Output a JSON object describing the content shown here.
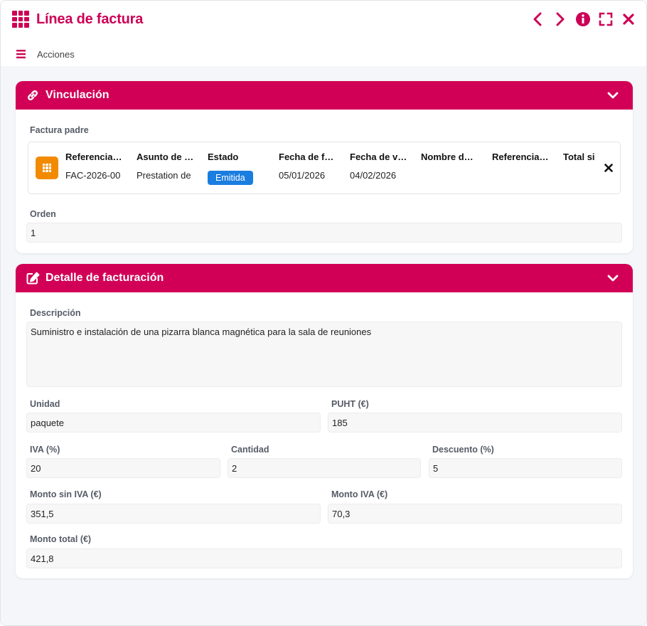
{
  "window": {
    "title": "Línea de factura"
  },
  "toolbar": {
    "actions_label": "Acciones"
  },
  "colors": {
    "accent": "#d10056",
    "badge": "#1a7de0",
    "thumb": "#f28a00"
  },
  "vinculacion": {
    "title": "Vinculación",
    "parent_label": "Factura padre",
    "columns": [
      "Referencia…",
      "Asunto de …",
      "Estado",
      "Fecha de f…",
      "Fecha de v…",
      "Nombre d…",
      "Referencia…",
      "Total si"
    ],
    "row": {
      "referencia": "FAC-2026-00",
      "asunto": "Prestation de",
      "estado": "Emitida",
      "fecha_f": "05/01/2026",
      "fecha_v": "04/02/2026"
    },
    "orden_label": "Orden",
    "orden_value": "1"
  },
  "detalle": {
    "title": "Detalle de facturación",
    "descripcion_label": "Descripción",
    "descripcion_value": "Suministro e instalación de una pizarra blanca magnética para la sala de reuniones",
    "unidad_label": "Unidad",
    "unidad_value": "paquete",
    "puht_label": "PUHT (€)",
    "puht_value": "185",
    "iva_label": "IVA (%)",
    "iva_value": "20",
    "cantidad_label": "Cantidad",
    "cantidad_value": "2",
    "descuento_label": "Descuento (%)",
    "descuento_value": "5",
    "monto_sin_iva_label": "Monto sin IVA (€)",
    "monto_sin_iva_value": "351,5",
    "monto_iva_label": "Monto IVA (€)",
    "monto_iva_value": "70,3",
    "monto_total_label": "Monto total (€)",
    "monto_total_value": "421,8"
  }
}
